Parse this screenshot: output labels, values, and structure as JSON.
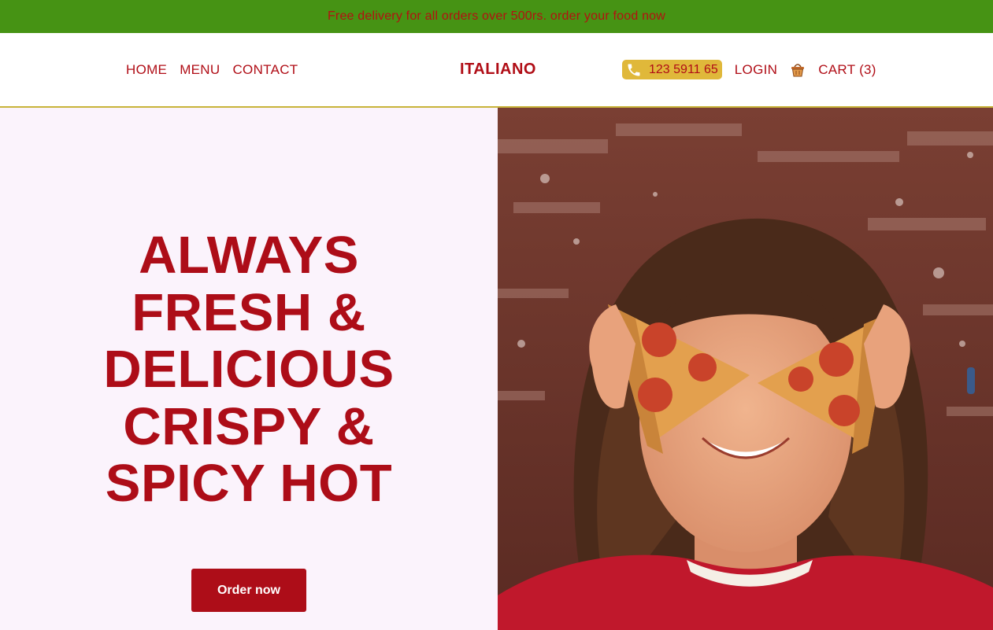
{
  "promo": {
    "text": "Free delivery for all orders over 500rs. order your food now"
  },
  "nav": {
    "links": [
      "HOME",
      "MENU",
      "CONTACT"
    ],
    "logo": "ITALIANO",
    "phone": "123 5911 65",
    "login": "LOGIN",
    "cart": "CART (3)"
  },
  "hero": {
    "headline_lines": [
      "ALWAYS",
      "FRESH &",
      "DELICIOUS",
      "CRISPY &",
      "SPICY HOT"
    ],
    "cta": "Order now"
  },
  "colors": {
    "promo_bg": "#469314",
    "brand_red": "#ad0d18",
    "accent_gold": "#e0b83a",
    "hero_bg": "#fbf3fc"
  },
  "icons": {
    "phone": "phone-icon",
    "cart": "basket-icon"
  }
}
